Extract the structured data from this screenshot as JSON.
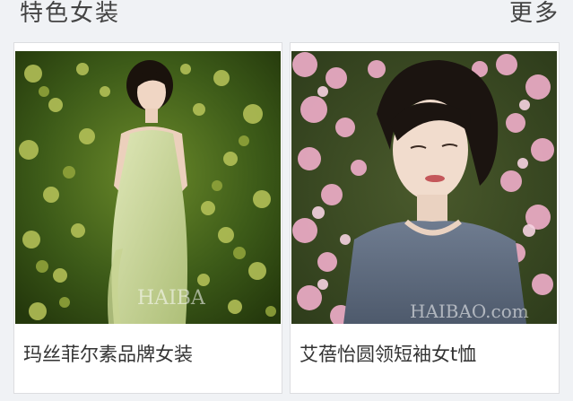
{
  "section": {
    "title": "特色女装",
    "more_label": "更多"
  },
  "products": [
    {
      "name": "玛丝菲尔素品牌女装",
      "watermark": "HAIBA"
    },
    {
      "name": "艾蓓怡圆领短袖女t恤",
      "watermark": "HAIBAO.com"
    }
  ],
  "colors": {
    "background": "#f0f2f5",
    "card": "#ffffff",
    "text": "#333333"
  }
}
